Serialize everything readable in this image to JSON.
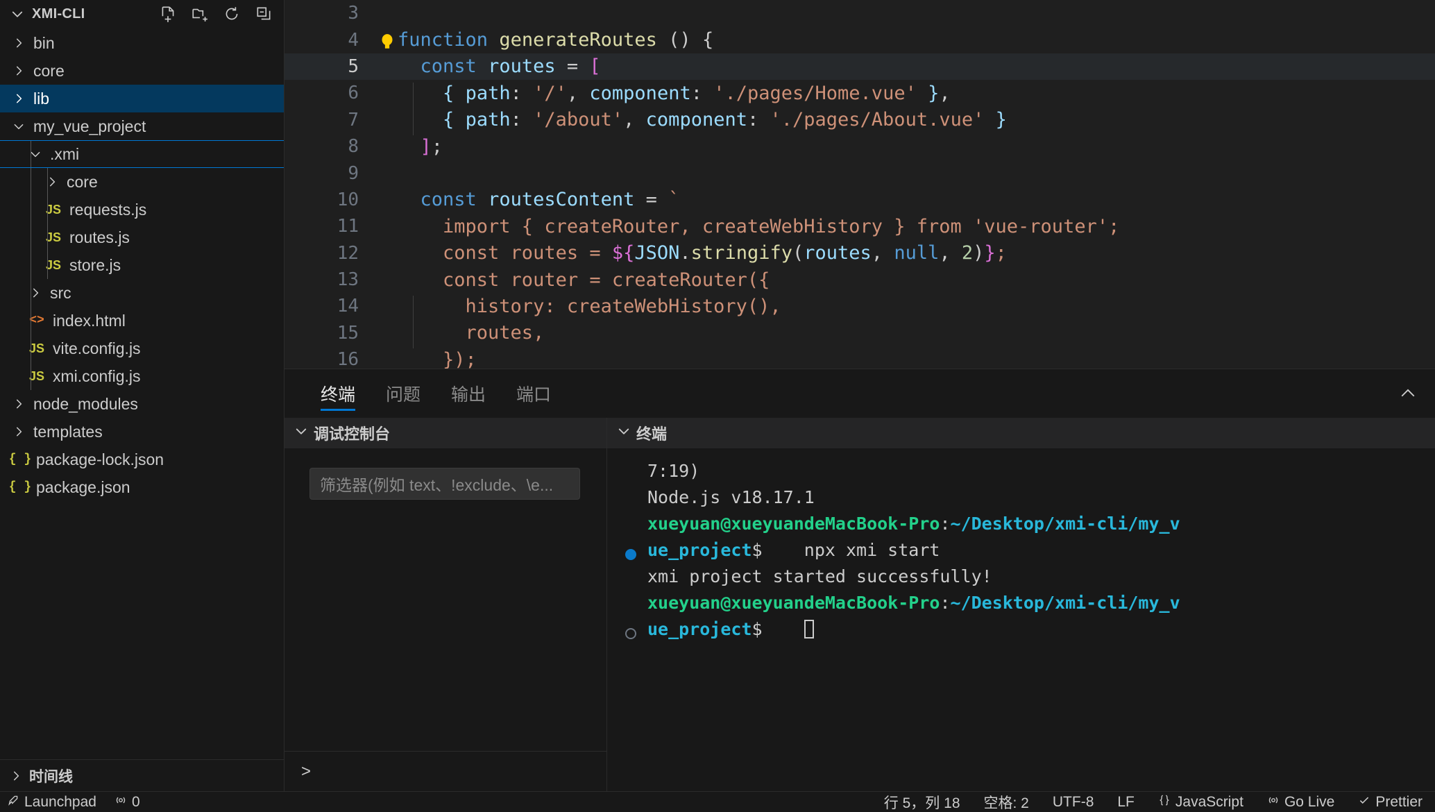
{
  "sidebar": {
    "title": "XMI-CLI",
    "header_actions": [
      {
        "name": "new-file-icon",
        "label": "New File"
      },
      {
        "name": "new-folder-icon",
        "label": "New Folder"
      },
      {
        "name": "refresh-icon",
        "label": "Refresh Explorer"
      },
      {
        "name": "collapse-all-icon",
        "label": "Collapse Folders in Explorer"
      }
    ],
    "tree": [
      {
        "label": "bin",
        "kind": "folder",
        "depth": 1,
        "expanded": false,
        "selected": false
      },
      {
        "label": "core",
        "kind": "folder",
        "depth": 1,
        "expanded": false,
        "selected": false
      },
      {
        "label": "lib",
        "kind": "folder",
        "depth": 1,
        "expanded": false,
        "selected": true
      },
      {
        "label": "my_vue_project",
        "kind": "folder",
        "depth": 1,
        "expanded": true,
        "selected": false
      },
      {
        "label": ".xmi",
        "kind": "folder",
        "depth": 2,
        "expanded": true,
        "selected": false,
        "focused": true
      },
      {
        "label": "core",
        "kind": "folder",
        "depth": 3,
        "expanded": false,
        "selected": false
      },
      {
        "label": "requests.js",
        "kind": "js",
        "depth": 3
      },
      {
        "label": "routes.js",
        "kind": "js",
        "depth": 3
      },
      {
        "label": "store.js",
        "kind": "js",
        "depth": 3
      },
      {
        "label": "src",
        "kind": "folder",
        "depth": 2,
        "expanded": false,
        "selected": false
      },
      {
        "label": "index.html",
        "kind": "html",
        "depth": 2
      },
      {
        "label": "vite.config.js",
        "kind": "js",
        "depth": 2
      },
      {
        "label": "xmi.config.js",
        "kind": "js",
        "depth": 2
      },
      {
        "label": "node_modules",
        "kind": "folder",
        "depth": 1,
        "expanded": false,
        "selected": false
      },
      {
        "label": "templates",
        "kind": "folder",
        "depth": 1,
        "expanded": false,
        "selected": false
      },
      {
        "label": "package-lock.json",
        "kind": "json",
        "depth": 1
      },
      {
        "label": "package.json",
        "kind": "json",
        "depth": 1
      }
    ],
    "timeline_label": "时间线"
  },
  "editor": {
    "language": "JavaScript",
    "first_visible_line": 3,
    "active_line": 5,
    "lightbulb": "lightbulb-icon",
    "lines": [
      {
        "n": "3",
        "tokens": []
      },
      {
        "n": "4",
        "tokens": [
          {
            "t": "function",
            "c": "kw"
          },
          {
            "t": " ",
            "c": "punc"
          },
          {
            "t": "generateRoutes",
            "c": "fn"
          },
          {
            "t": " ",
            "c": "punc"
          },
          {
            "t": "()",
            "c": "punc"
          },
          {
            "t": " ",
            "c": "punc"
          },
          {
            "t": "{",
            "c": "punc"
          }
        ]
      },
      {
        "n": "5",
        "active": true,
        "tokens": [
          {
            "t": "  ",
            "c": "punc"
          },
          {
            "t": "const",
            "c": "kw"
          },
          {
            "t": " ",
            "c": "punc"
          },
          {
            "t": "routes",
            "c": "var"
          },
          {
            "t": " ",
            "c": "punc"
          },
          {
            "t": "=",
            "c": "punc"
          },
          {
            "t": " ",
            "c": "punc"
          },
          {
            "t": "[",
            "c": "brk"
          }
        ]
      },
      {
        "n": "6",
        "guide": true,
        "tokens": [
          {
            "t": "    ",
            "c": "punc"
          },
          {
            "t": "{",
            "c": "var"
          },
          {
            "t": " ",
            "c": "punc"
          },
          {
            "t": "path",
            "c": "var"
          },
          {
            "t": ": ",
            "c": "punc"
          },
          {
            "t": "'/'",
            "c": "str"
          },
          {
            "t": ", ",
            "c": "punc"
          },
          {
            "t": "component",
            "c": "var"
          },
          {
            "t": ": ",
            "c": "punc"
          },
          {
            "t": "'./pages/Home.vue'",
            "c": "str"
          },
          {
            "t": " ",
            "c": "punc"
          },
          {
            "t": "}",
            "c": "var"
          },
          {
            "t": ",",
            "c": "punc"
          }
        ]
      },
      {
        "n": "7",
        "guide": true,
        "tokens": [
          {
            "t": "    ",
            "c": "punc"
          },
          {
            "t": "{",
            "c": "var"
          },
          {
            "t": " ",
            "c": "punc"
          },
          {
            "t": "path",
            "c": "var"
          },
          {
            "t": ": ",
            "c": "punc"
          },
          {
            "t": "'/about'",
            "c": "str"
          },
          {
            "t": ", ",
            "c": "punc"
          },
          {
            "t": "component",
            "c": "var"
          },
          {
            "t": ": ",
            "c": "punc"
          },
          {
            "t": "'./pages/About.vue'",
            "c": "str"
          },
          {
            "t": " ",
            "c": "punc"
          },
          {
            "t": "}",
            "c": "var"
          }
        ]
      },
      {
        "n": "8",
        "tokens": [
          {
            "t": "  ",
            "c": "punc"
          },
          {
            "t": "]",
            "c": "brk"
          },
          {
            "t": ";",
            "c": "punc"
          }
        ]
      },
      {
        "n": "9",
        "tokens": []
      },
      {
        "n": "10",
        "tokens": [
          {
            "t": "  ",
            "c": "punc"
          },
          {
            "t": "const",
            "c": "kw"
          },
          {
            "t": " ",
            "c": "punc"
          },
          {
            "t": "routesContent",
            "c": "var"
          },
          {
            "t": " ",
            "c": "punc"
          },
          {
            "t": "=",
            "c": "punc"
          },
          {
            "t": " ",
            "c": "punc"
          },
          {
            "t": "`",
            "c": "str"
          }
        ]
      },
      {
        "n": "11",
        "tokens": [
          {
            "t": "    import { createRouter, createWebHistory } from 'vue-router';",
            "c": "str"
          }
        ]
      },
      {
        "n": "12",
        "tokens": [
          {
            "t": "    const routes = ",
            "c": "str"
          },
          {
            "t": "${",
            "c": "brk"
          },
          {
            "t": "JSON",
            "c": "var"
          },
          {
            "t": ".",
            "c": "punc"
          },
          {
            "t": "stringify",
            "c": "fn"
          },
          {
            "t": "(",
            "c": "punc"
          },
          {
            "t": "routes",
            "c": "var"
          },
          {
            "t": ", ",
            "c": "punc"
          },
          {
            "t": "null",
            "c": "kw"
          },
          {
            "t": ", ",
            "c": "punc"
          },
          {
            "t": "2",
            "c": "num"
          },
          {
            "t": ")",
            "c": "punc"
          },
          {
            "t": "}",
            "c": "brk"
          },
          {
            "t": ";",
            "c": "str"
          }
        ]
      },
      {
        "n": "13",
        "tokens": [
          {
            "t": "    const router = createRouter({",
            "c": "str"
          }
        ]
      },
      {
        "n": "14",
        "guide": true,
        "tokens": [
          {
            "t": "      history: createWebHistory(),",
            "c": "str"
          }
        ]
      },
      {
        "n": "15",
        "guide": true,
        "tokens": [
          {
            "t": "      routes,",
            "c": "str"
          }
        ]
      },
      {
        "n": "16",
        "tokens": [
          {
            "t": "    });",
            "c": "str"
          }
        ]
      }
    ]
  },
  "panel": {
    "tabs": [
      {
        "label": "终端",
        "active": true
      },
      {
        "label": "问题",
        "active": false
      },
      {
        "label": "输出",
        "active": false
      },
      {
        "label": "端口",
        "active": false
      }
    ],
    "actions": [
      {
        "name": "chevron-up-icon",
        "label": "Maximize Panel Size"
      }
    ],
    "debug_console": {
      "title": "调试控制台",
      "filter_placeholder": "筛选器(例如 text、!exclude、\\e...",
      "repl_prompt": ">"
    },
    "terminal": {
      "title": "终端",
      "lines": [
        {
          "marker": "none",
          "segments": [
            {
              "t": "7:19)",
              "c": "w"
            }
          ]
        },
        {
          "marker": "none",
          "segments": [
            {
              "t": "",
              "c": "w"
            }
          ]
        },
        {
          "marker": "none",
          "segments": [
            {
              "t": "Node.js v18.17.1",
              "c": "w"
            }
          ]
        },
        {
          "marker": "none",
          "segments": [
            {
              "t": "xueyuan@xueyuandeMacBook-Pro",
              "c": "g"
            },
            {
              "t": ":",
              "c": "w"
            },
            {
              "t": "~/Desktop/xmi-cli/my_v",
              "c": "c"
            }
          ]
        },
        {
          "marker": "filled",
          "segments": [
            {
              "t": "ue_project",
              "c": "c"
            },
            {
              "t": "$    npx xmi start",
              "c": "w"
            }
          ]
        },
        {
          "marker": "none",
          "segments": [
            {
              "t": "xmi project started successfully!",
              "c": "w"
            }
          ]
        },
        {
          "marker": "none",
          "segments": [
            {
              "t": "xueyuan@xueyuandeMacBook-Pro",
              "c": "g"
            },
            {
              "t": ":",
              "c": "w"
            },
            {
              "t": "~/Desktop/xmi-cli/my_v",
              "c": "c"
            }
          ]
        },
        {
          "marker": "hollow",
          "segments": [
            {
              "t": "ue_project",
              "c": "c"
            },
            {
              "t": "$    ",
              "c": "w"
            }
          ],
          "cursor": true
        }
      ]
    }
  },
  "statusbar": {
    "left": [
      {
        "name": "launchpad",
        "icon": "rocket-icon",
        "label": "Launchpad"
      },
      {
        "name": "radio-tower",
        "icon": "broadcast-icon",
        "label": "0"
      }
    ],
    "right": [
      {
        "name": "line-col",
        "label": "行 5，列 18"
      },
      {
        "name": "indentation",
        "label": "空格: 2"
      },
      {
        "name": "encoding",
        "label": "UTF-8"
      },
      {
        "name": "eol",
        "label": "LF"
      },
      {
        "name": "language-mode",
        "icon": "braces-icon",
        "label": "JavaScript"
      },
      {
        "name": "go-live",
        "icon": "broadcast-icon",
        "label": "Go Live"
      },
      {
        "name": "prettier",
        "icon": "check-icon",
        "label": "Prettier"
      }
    ]
  },
  "colors": {
    "accent": "#0078d4",
    "selection": "#04395e",
    "sidebar_bg": "#181818",
    "editor_bg": "#1f1f1f",
    "terminal_green": "#23d18b",
    "terminal_cyan": "#29b8db"
  }
}
